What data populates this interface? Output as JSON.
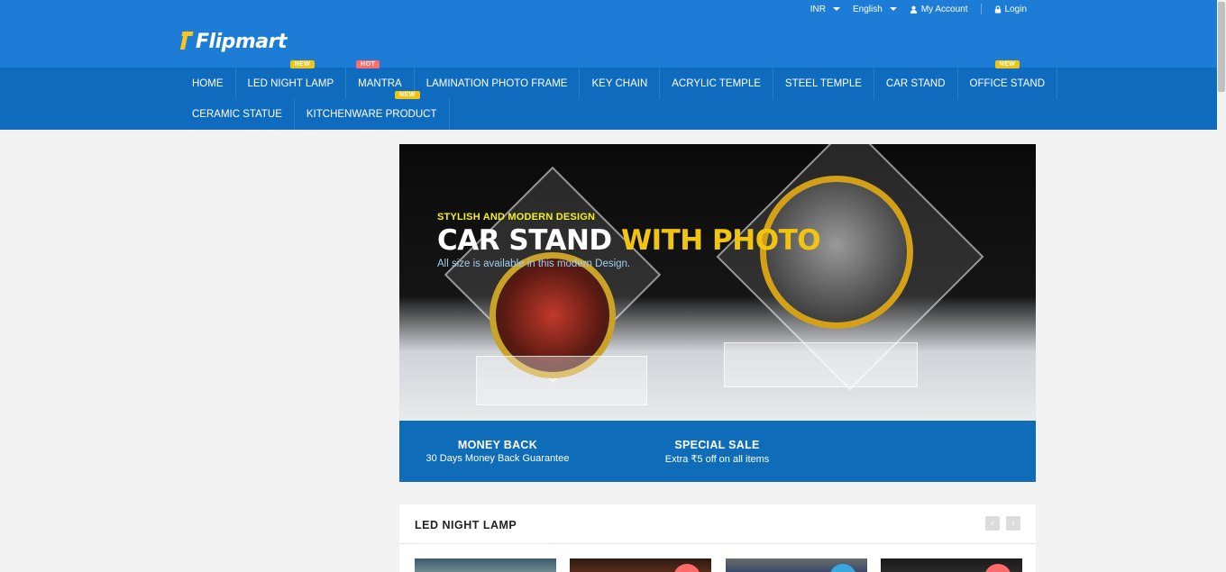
{
  "top_links": {
    "currency": "INR",
    "language": "English",
    "account": "My Account",
    "login": "Login"
  },
  "logo": {
    "text": "Flipmart"
  },
  "nav": {
    "items": [
      {
        "label": "HOME",
        "badge": ""
      },
      {
        "label": "LED NIGHT LAMP",
        "badge": "NEW"
      },
      {
        "label": "MANTRA",
        "badge": "HOT"
      },
      {
        "label": "LAMINATION PHOTO FRAME",
        "badge": ""
      },
      {
        "label": "KEY CHAIN",
        "badge": ""
      },
      {
        "label": "ACRYLIC TEMPLE",
        "badge": ""
      },
      {
        "label": "STEEL TEMPLE",
        "badge": ""
      },
      {
        "label": "CAR STAND",
        "badge": ""
      },
      {
        "label": "OFFICE STAND",
        "badge": "NEW"
      },
      {
        "label": "CERAMIC STATUE",
        "badge": ""
      },
      {
        "label": "KITCHENWARE PRODUCT",
        "badge": "NEW"
      }
    ]
  },
  "hero": {
    "subtitle": "STYLISH AND MODERN DESIGN",
    "title_main": "CAR STAND ",
    "title_highlight": "WITH PHOTO",
    "description": "All size is available in this modern Design."
  },
  "info": [
    {
      "title": "MONEY BACK",
      "text": "30 Days Money Back Guarantee"
    },
    {
      "title": "SPECIAL SALE",
      "text": "Extra ₹5 off on all items"
    }
  ],
  "section": {
    "title": "LED NIGHT LAMP",
    "prev_icon": "‹",
    "next_icon": "›"
  },
  "colors": {
    "topbar": "#1d7dd6",
    "nav": "#0e6bbd",
    "accent_yellow": "#f1c40f",
    "badge_hot": "#ff6b6b"
  }
}
